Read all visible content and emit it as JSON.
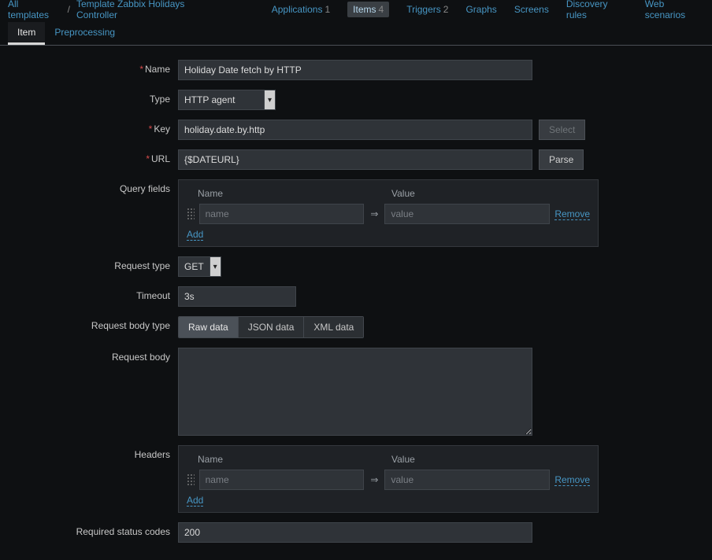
{
  "breadcrumb": {
    "all_templates": "All templates",
    "template_name": "Template Zabbix Holidays Controller"
  },
  "nav": {
    "applications": {
      "label": "Applications",
      "count": "1"
    },
    "items": {
      "label": "Items",
      "count": "4"
    },
    "triggers": {
      "label": "Triggers",
      "count": "2"
    },
    "graphs": "Graphs",
    "screens": "Screens",
    "discovery": "Discovery rules",
    "web": "Web scenarios"
  },
  "tabs": {
    "item": "Item",
    "preprocessing": "Preprocessing"
  },
  "labels": {
    "name": "Name",
    "type": "Type",
    "key": "Key",
    "url": "URL",
    "query_fields": "Query fields",
    "request_type": "Request type",
    "timeout": "Timeout",
    "request_body_type": "Request body type",
    "request_body": "Request body",
    "headers": "Headers",
    "required_status_codes": "Required status codes"
  },
  "values": {
    "name": "Holiday Date fetch by HTTP",
    "type": "HTTP agent",
    "key": "holiday.date.by.http",
    "url": "{$DATEURL}",
    "request_type": "GET",
    "timeout": "3s",
    "required_status_codes": "200"
  },
  "buttons": {
    "select": "Select",
    "parse": "Parse",
    "add": "Add",
    "remove": "Remove"
  },
  "field_headers": {
    "name": "Name",
    "value": "Value"
  },
  "placeholders": {
    "name": "name",
    "value": "value"
  },
  "body_type": {
    "raw": "Raw data",
    "json": "JSON data",
    "xml": "XML data"
  }
}
